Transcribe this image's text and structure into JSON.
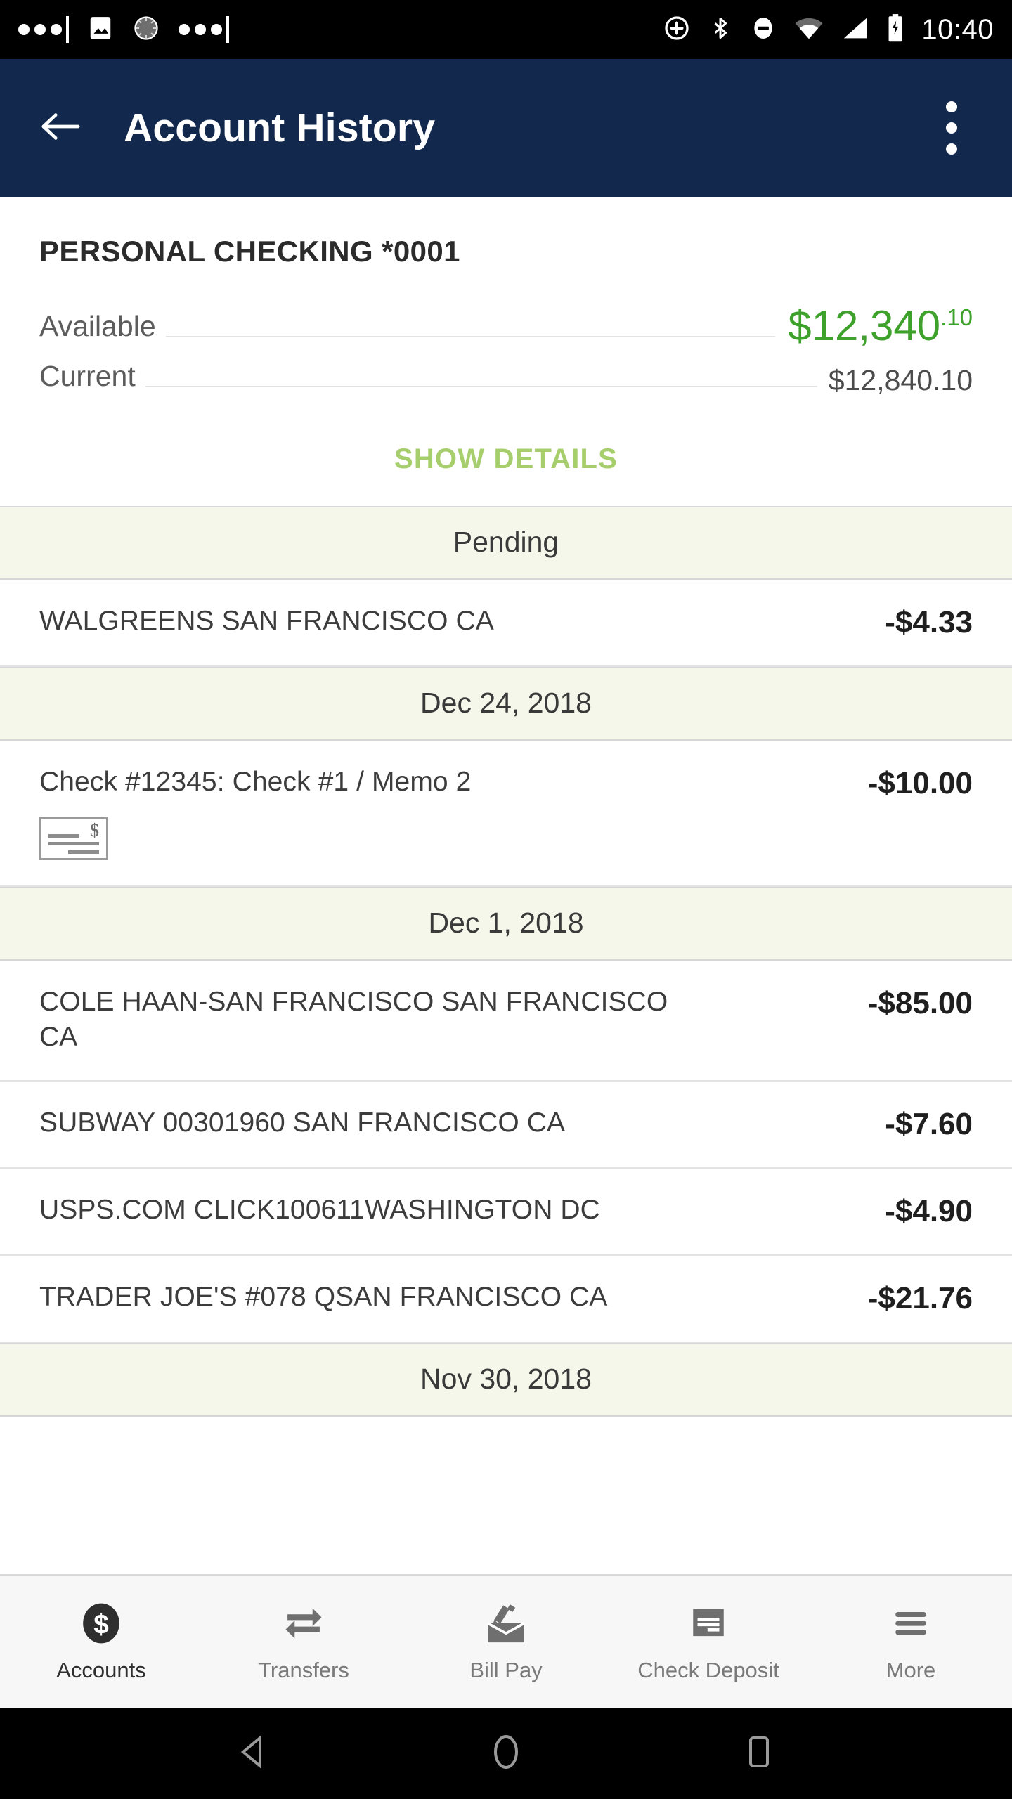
{
  "status_bar": {
    "time": "10:40",
    "left_icons": [
      "more-dots-icon",
      "image-icon",
      "sync-spinner-icon",
      "more-dots-icon"
    ],
    "right_icons": [
      "add-circle-icon",
      "bluetooth-icon",
      "do-not-disturb-icon",
      "wifi-icon",
      "cellular-signal-icon",
      "battery-charging-icon"
    ]
  },
  "app_bar": {
    "title": "Account History",
    "back_icon": "arrow-left-icon",
    "overflow_icon": "more-vertical-icon"
  },
  "summary": {
    "account_name": "PERSONAL CHECKING *0001",
    "available_label": "Available",
    "available_dollars": "$12,340",
    "available_cents": ".10",
    "current_label": "Current",
    "current_amount": "$12,840.10",
    "show_details_label": "SHOW DETAILS",
    "available_color": "#3ea12c",
    "show_details_color": "#a7ce6d"
  },
  "sections": [
    {
      "header": "Pending",
      "transactions": [
        {
          "description": "WALGREENS SAN FRANCISCO CA",
          "amount": "-$4.33",
          "has_check_image": false
        }
      ]
    },
    {
      "header": "Dec 24, 2018",
      "transactions": [
        {
          "description": "Check #12345: Check #1 / Memo 2",
          "amount": "-$10.00",
          "has_check_image": true,
          "check_icon": "check-image-icon"
        }
      ]
    },
    {
      "header": "Dec 1, 2018",
      "transactions": [
        {
          "description": "COLE HAAN-SAN FRANCISCO SAN FRANCISCO CA",
          "amount": "-$85.00",
          "has_check_image": false
        },
        {
          "description": "SUBWAY 00301960 SAN FRANCISCO CA",
          "amount": "-$7.60",
          "has_check_image": false
        },
        {
          "description": "USPS.COM CLICK100611WASHINGTON DC",
          "amount": "-$4.90",
          "has_check_image": false
        },
        {
          "description": "TRADER JOE'S #078 QSAN FRANCISCO CA",
          "amount": "-$21.76",
          "has_check_image": false
        }
      ]
    },
    {
      "header": "Nov 30, 2018",
      "transactions": []
    }
  ],
  "tab_bar": {
    "tabs": [
      {
        "label": "Accounts",
        "icon": "dollar-circle-icon",
        "active": true
      },
      {
        "label": "Transfers",
        "icon": "transfer-arrows-icon",
        "active": false
      },
      {
        "label": "Bill Pay",
        "icon": "envelope-pen-icon",
        "active": false
      },
      {
        "label": "Check Deposit",
        "icon": "check-deposit-icon",
        "active": false
      },
      {
        "label": "More",
        "icon": "hamburger-menu-icon",
        "active": false
      }
    ]
  },
  "nav_bar": {
    "back_icon": "nav-back-triangle-icon",
    "home_icon": "nav-home-circle-icon",
    "recents_icon": "nav-recents-square-icon"
  },
  "theme": {
    "app_bar_color": "#12284c",
    "section_header_bg": "#f4f7e9"
  }
}
